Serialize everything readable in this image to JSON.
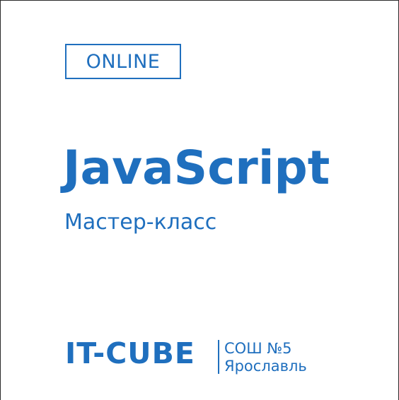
{
  "badge": {
    "label": "ONLINE"
  },
  "main": {
    "title": "JavaScript",
    "subtitle": "Мастер-класс"
  },
  "footer": {
    "logo_text": "IT-CUBE",
    "school_line1": "СОШ №5",
    "school_line2": "Ярославль"
  },
  "colors": {
    "accent": "#1f6fbe",
    "background": "#ffffff",
    "frame": "#2a2a2a"
  }
}
